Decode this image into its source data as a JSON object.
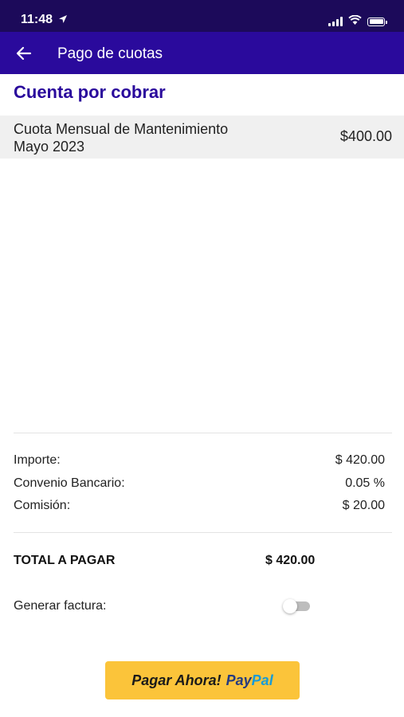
{
  "status_bar": {
    "time": "11:48"
  },
  "app_bar": {
    "title": "Pago de cuotas"
  },
  "section": {
    "title": "Cuenta por cobrar"
  },
  "charges": [
    {
      "description_line1": "Cuota Mensual de Mantenimiento",
      "description_line2": "Mayo 2023",
      "amount": "$400.00"
    }
  ],
  "summary": {
    "importe_label": "Importe:",
    "importe_value": "$ 420.00",
    "convenio_label": "Convenio Bancario:",
    "convenio_value": "0.05 %",
    "comision_label": "Comisión:",
    "comision_value": "$ 20.00",
    "total_label": "TOTAL A PAGAR",
    "total_value": "$ 420.00"
  },
  "invoice": {
    "label": "Generar factura:",
    "enabled": false
  },
  "pay_button": {
    "label": "Pagar Ahora!",
    "brand_part1": "Pay",
    "brand_part2": "Pal"
  },
  "colors": {
    "status_bar": "#1c0a5a",
    "app_bar": "#2a0a9c",
    "accent": "#2a0a9c",
    "pay_button": "#fbc43a",
    "paypal_dark": "#253b80",
    "paypal_light": "#179bd7"
  },
  "icons": [
    "location-arrow-icon",
    "signal-icon",
    "wifi-icon",
    "battery-icon",
    "back-arrow-icon"
  ]
}
